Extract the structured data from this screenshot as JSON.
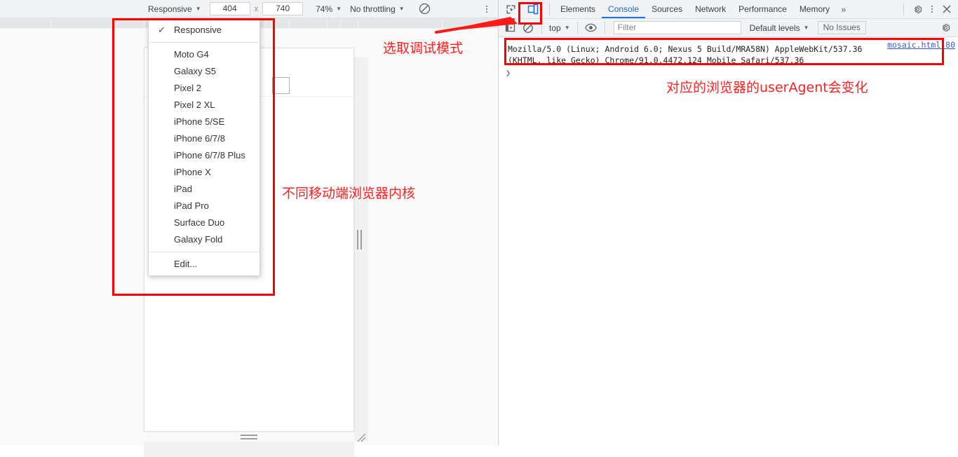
{
  "device_toolbar": {
    "device_select": "Responsive",
    "width_value": "404",
    "height_value": "740",
    "separator": "x",
    "zoom_value": "74%",
    "throttling": "No throttling",
    "rotate_icon": "rotate-disabled-icon",
    "kebab_icon": "more-options-icon"
  },
  "device_menu": {
    "items": [
      {
        "label": "Responsive",
        "checked": true,
        "check_glyph": "✓"
      },
      {
        "label": "Moto G4",
        "checked": false
      },
      {
        "label": "Galaxy S5",
        "checked": false
      },
      {
        "label": "Pixel 2",
        "checked": false
      },
      {
        "label": "Pixel 2 XL",
        "checked": false
      },
      {
        "label": "iPhone 5/SE",
        "checked": false
      },
      {
        "label": "iPhone 6/7/8",
        "checked": false
      },
      {
        "label": "iPhone 6/7/8 Plus",
        "checked": false
      },
      {
        "label": "iPhone X",
        "checked": false
      },
      {
        "label": "iPad",
        "checked": false
      },
      {
        "label": "iPad Pro",
        "checked": false
      },
      {
        "label": "Surface Duo",
        "checked": false
      },
      {
        "label": "Galaxy Fold",
        "checked": false
      },
      {
        "label": "Edit...",
        "checked": false
      }
    ]
  },
  "devtools": {
    "inspect_icon": "inspect-element-icon",
    "device_toggle_icon": "device-toolbar-toggle-icon",
    "tabs": [
      {
        "label": "Elements",
        "active": false
      },
      {
        "label": "Console",
        "active": true
      },
      {
        "label": "Sources",
        "active": false
      },
      {
        "label": "Network",
        "active": false
      },
      {
        "label": "Performance",
        "active": false
      },
      {
        "label": "Memory",
        "active": false
      }
    ],
    "more_tabs_glyph": "»",
    "settings_icon": "gear-icon",
    "kebab_icon": "more-options-icon",
    "close_icon": "close-icon"
  },
  "console_toolbar": {
    "sidebar_icon": "console-sidebar-icon",
    "clear_icon": "clear-console-icon",
    "context": "top",
    "eye_icon": "live-expression-icon",
    "filter_placeholder": "Filter",
    "filter_value": "",
    "levels": "Default levels",
    "issues_label": "No Issues",
    "settings_icon": "gear-icon"
  },
  "console": {
    "log_line_1": "Mozilla/5.0 (Linux; Android 6.0; Nexus 5 Build/MRA58N) AppleWebKit/537.36",
    "log_line_2": "(KHTML, like Gecko) Chrome/91.0.4472.124 Mobile Safari/537.36",
    "source_link": "mosaic.html:80",
    "prompt_glyph": "❯"
  },
  "annotations": {
    "select_debug_mode": "选取调试模式",
    "mobile_kernels": "不同移动端浏览器内核",
    "user_agent_changes": "对应的浏览器的userAgent会变化",
    "accent_color": "#ff0000"
  },
  "page_content": {
    "input_box": "text-input-field"
  }
}
